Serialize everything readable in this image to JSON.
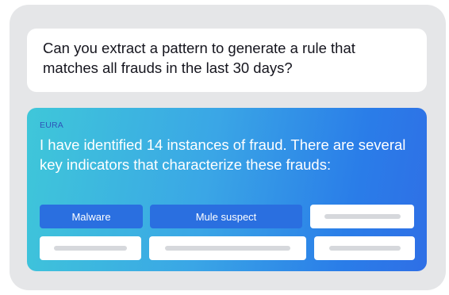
{
  "conversation": {
    "user_message": "Can you extract a pattern to generate a rule that matches all frauds in the last 30 days?",
    "assistant_name": "EURA",
    "assistant_message": "I have identified 14 instances of fraud. There are several key indicators that characterize these frauds:"
  },
  "indicators": {
    "row1": [
      {
        "label": "Malware",
        "style": "filled"
      },
      {
        "label": "Mule suspect",
        "style": "filled"
      },
      {
        "label": "",
        "style": "placeholder"
      }
    ],
    "row2": [
      {
        "label": "",
        "style": "placeholder"
      },
      {
        "label": "",
        "style": "placeholder"
      },
      {
        "label": "",
        "style": "placeholder"
      }
    ]
  },
  "colors": {
    "panel_background": "#e5e6e8",
    "card_gradient_start": "#3fc7d9",
    "card_gradient_end": "#2f6fe6",
    "chip_filled": "#2a6fe0",
    "speaker_label": "#2e55b8"
  }
}
